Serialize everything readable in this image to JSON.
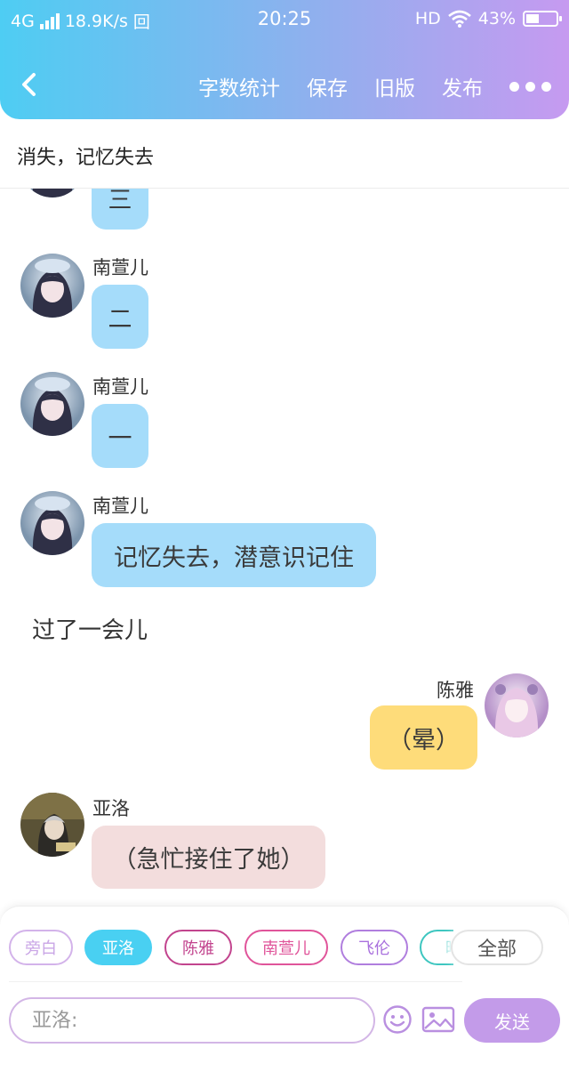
{
  "status_bar": {
    "network": "4G",
    "speed": "18.9K/s",
    "extra_icon": "回",
    "time": "20:25",
    "hd": "HD",
    "battery": "43%"
  },
  "nav": {
    "actions": [
      "字数统计",
      "保存",
      "旧版",
      "发布"
    ]
  },
  "title": "消失，记忆失去",
  "chat": {
    "items": [
      {
        "type": "message",
        "side": "left",
        "sender": "",
        "text": "三",
        "color": "blue",
        "avatar": "girl-blue"
      },
      {
        "type": "message",
        "side": "left",
        "sender": "南萱儿",
        "text": "二",
        "color": "blue",
        "avatar": "girl-blue"
      },
      {
        "type": "message",
        "side": "left",
        "sender": "南萱儿",
        "text": "一",
        "color": "blue",
        "avatar": "girl-blue"
      },
      {
        "type": "message",
        "side": "left",
        "sender": "南萱儿",
        "text": "记忆失去，潜意识记住",
        "color": "blue",
        "avatar": "girl-blue"
      },
      {
        "type": "narration",
        "text": "过了一会儿"
      },
      {
        "type": "message",
        "side": "right",
        "sender": "陈雅",
        "text": "（晕）",
        "color": "yellow",
        "avatar": "girl-pink"
      },
      {
        "type": "message",
        "side": "left",
        "sender": "亚洛",
        "text": "（急忙接住了她）",
        "color": "pink",
        "avatar": "boy-dark"
      }
    ]
  },
  "characters": [
    {
      "label": "旁白",
      "color": "#d3b3ea",
      "text_color": "#c9a5e6",
      "selected": false
    },
    {
      "label": "亚洛",
      "color": "#49d0f2",
      "text_color": "#ffffff",
      "selected": true
    },
    {
      "label": "陈雅",
      "color": "#c2448e",
      "text_color": "#c2448e",
      "selected": false
    },
    {
      "label": "南萱儿",
      "color": "#e0549a",
      "text_color": "#e0549a",
      "selected": false
    },
    {
      "label": "飞伦",
      "color": "#b07ede",
      "text_color": "#a970dd",
      "selected": false
    },
    {
      "label": "晴",
      "color": "#3ec6c0",
      "text_color": "#3ec6c0",
      "selected": false
    }
  ],
  "all_button": "全部",
  "input": {
    "placeholder": "亚洛:"
  },
  "send_button": "发送",
  "colors": {
    "header_gradient": [
      "#4ecdf3",
      "#8fb0ee",
      "#c69af0"
    ],
    "bubble_blue": "#a5dcfa",
    "bubble_yellow": "#fedc7a",
    "bubble_pink": "#f3dddd",
    "send": "#c39be9",
    "input_border": "#d3b6e6"
  },
  "icons": [
    "back-icon",
    "more-icon",
    "emoji-icon",
    "image-icon",
    "wifi-icon",
    "battery-icon",
    "signal-icon"
  ]
}
